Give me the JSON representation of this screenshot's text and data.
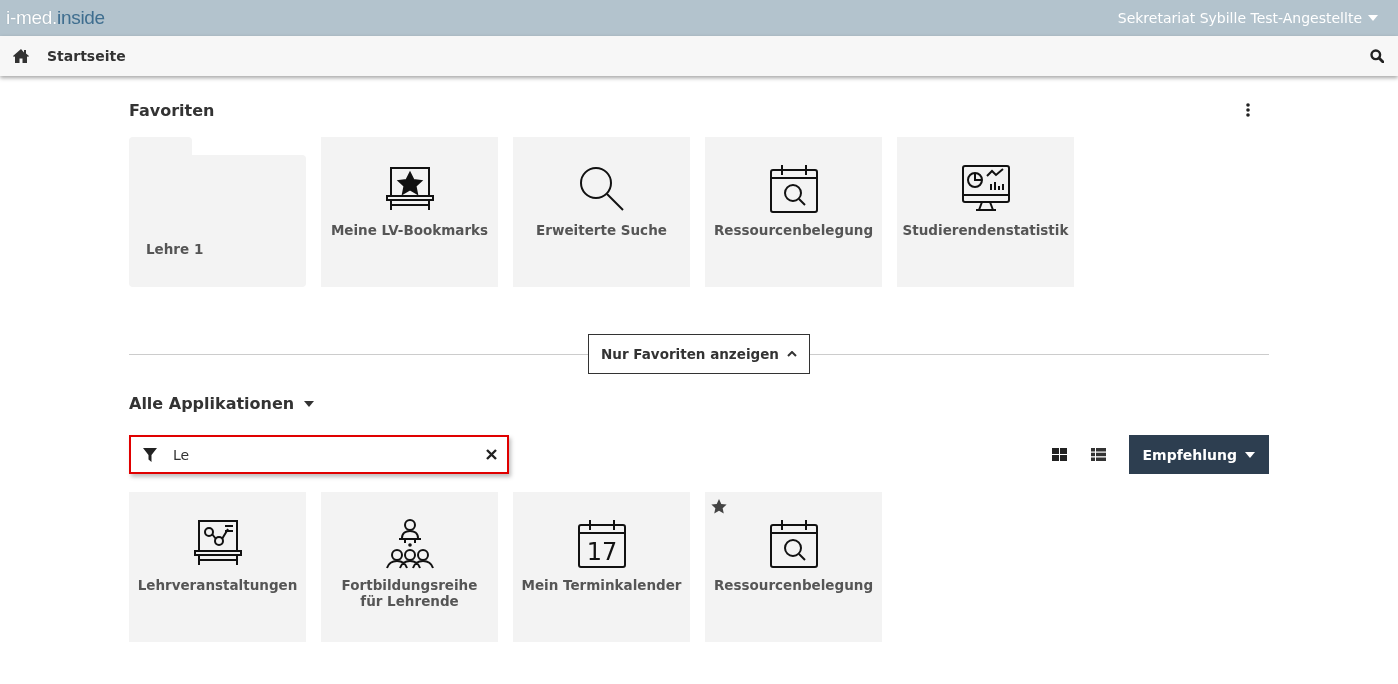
{
  "header": {
    "logo_light": "i-med.",
    "logo_dark": "inside",
    "user": "Sekretariat Sybille Test-Angestellte"
  },
  "nav": {
    "home_label": "Startseite"
  },
  "favorites": {
    "title": "Favoriten",
    "tiles": [
      {
        "kind": "folder",
        "label": "Lehre 1"
      },
      {
        "kind": "app",
        "label": "Meine LV-Bookmarks",
        "favorite": false
      },
      {
        "kind": "app",
        "label": "Erweiterte Suche",
        "favorite": false
      },
      {
        "kind": "app",
        "label": "Ressourcenbelegung",
        "favorite": false
      },
      {
        "kind": "app",
        "label": "Studierendenstatistik",
        "favorite": false
      }
    ]
  },
  "toggle_button": {
    "label": "Nur Favoriten anzeigen",
    "expanded": true
  },
  "apps": {
    "title": "Alle Applikationen",
    "filter": {
      "value": "Le"
    },
    "sort_button": "Empfehlung",
    "tiles": [
      {
        "kind": "app",
        "label": "Lehrveranstaltungen",
        "favorite": false
      },
      {
        "kind": "app",
        "label": "Fortbildungsreihe für Lehrende",
        "favorite": false
      },
      {
        "kind": "app",
        "icon_text": "17",
        "label": "Mein Terminkalender",
        "favorite": false
      },
      {
        "kind": "app",
        "label": "Ressourcenbelegung",
        "favorite": true
      }
    ]
  }
}
